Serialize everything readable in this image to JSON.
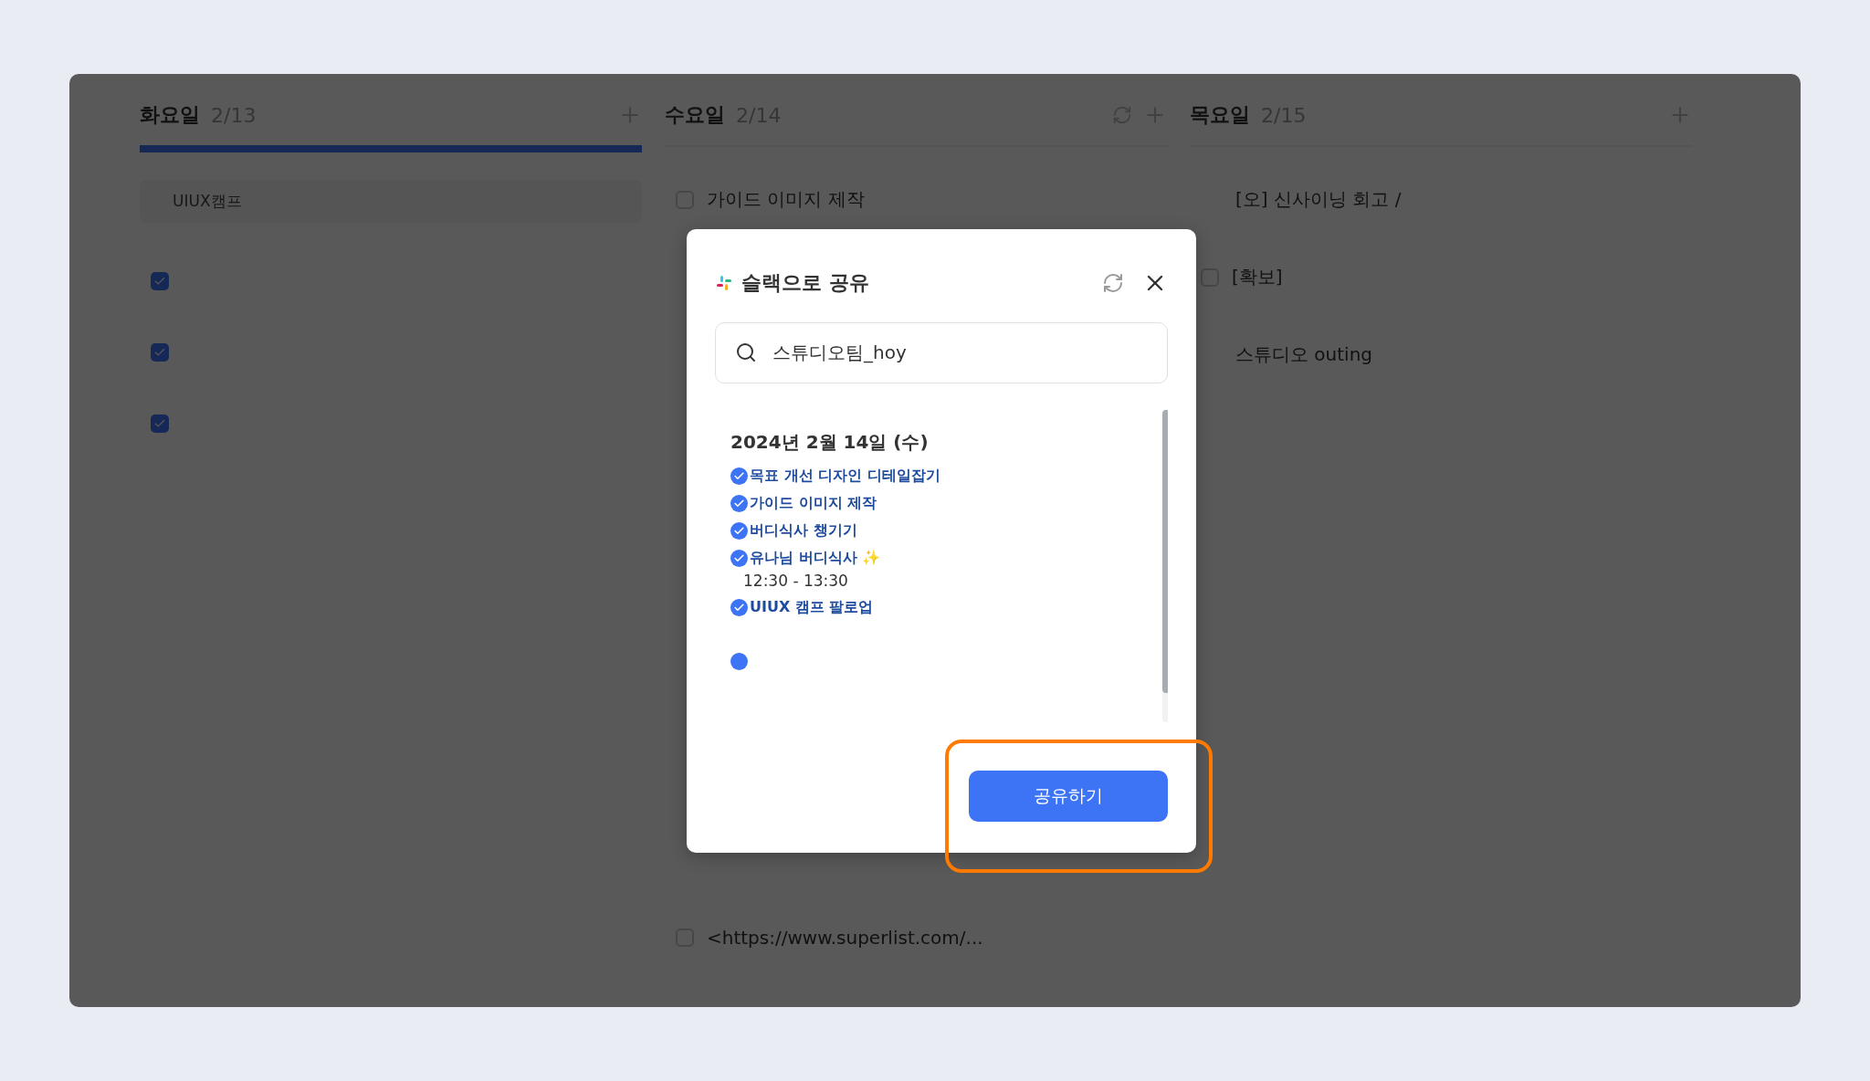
{
  "board": {
    "columns": [
      {
        "day": "화요일",
        "date": "2/13",
        "selected": true,
        "items": [
          {
            "kind": "section",
            "title": "UIUX캠프"
          },
          {
            "kind": "task",
            "checked": true
          },
          {
            "kind": "task",
            "checked": true
          },
          {
            "kind": "task",
            "checked": true
          }
        ]
      },
      {
        "day": "수요일",
        "date": "2/14",
        "selected": false,
        "sync": true,
        "items": [
          {
            "kind": "task",
            "checked": false,
            "title": "가이드 이미지 제작"
          },
          {
            "kind": "spacer"
          },
          {
            "kind": "task",
            "checked": false,
            "title": "<https://www.superlist.com/..."
          }
        ]
      },
      {
        "day": "목요일",
        "date": "2/15",
        "selected": false,
        "items": [
          {
            "kind": "event",
            "title": "[오] 신사이닝 회고 /"
          },
          {
            "kind": "task",
            "checked": false,
            "title": "[확보]"
          },
          {
            "kind": "event",
            "title": "스튜디오 outing"
          }
        ]
      }
    ]
  },
  "dialog": {
    "title": "슬랙으로 공유",
    "search": {
      "value": "스튜디오팀_hoy"
    },
    "preview": {
      "heading": "2024년 2월 14일 (수)",
      "items": [
        {
          "title": "목표 개선 디자인 디테일잡기",
          "checked": true
        },
        {
          "title": "가이드 이미지 제작",
          "checked": true
        },
        {
          "title": "버디식사 챙기기",
          "checked": true
        },
        {
          "title": "유나님 버디식사 ✨",
          "checked": true,
          "time": "12:30 - 13:30"
        },
        {
          "title": "UIUX 캠프 팔로업",
          "checked": true
        }
      ]
    },
    "button": "공유하기",
    "highlighted": true
  }
}
